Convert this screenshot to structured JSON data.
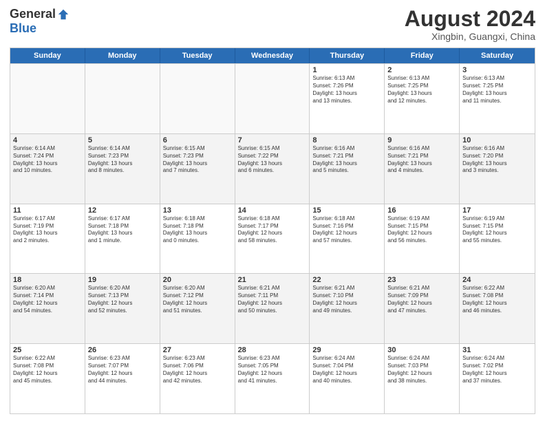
{
  "logo": {
    "general": "General",
    "blue": "Blue"
  },
  "title": "August 2024",
  "location": "Xingbin, Guangxi, China",
  "header_days": [
    "Sunday",
    "Monday",
    "Tuesday",
    "Wednesday",
    "Thursday",
    "Friday",
    "Saturday"
  ],
  "rows": [
    [
      {
        "num": "",
        "text": "",
        "empty": true
      },
      {
        "num": "",
        "text": "",
        "empty": true
      },
      {
        "num": "",
        "text": "",
        "empty": true
      },
      {
        "num": "",
        "text": "",
        "empty": true
      },
      {
        "num": "1",
        "text": "Sunrise: 6:13 AM\nSunset: 7:26 PM\nDaylight: 13 hours\nand 13 minutes.",
        "empty": false
      },
      {
        "num": "2",
        "text": "Sunrise: 6:13 AM\nSunset: 7:25 PM\nDaylight: 13 hours\nand 12 minutes.",
        "empty": false
      },
      {
        "num": "3",
        "text": "Sunrise: 6:13 AM\nSunset: 7:25 PM\nDaylight: 13 hours\nand 11 minutes.",
        "empty": false
      }
    ],
    [
      {
        "num": "4",
        "text": "Sunrise: 6:14 AM\nSunset: 7:24 PM\nDaylight: 13 hours\nand 10 minutes.",
        "empty": false
      },
      {
        "num": "5",
        "text": "Sunrise: 6:14 AM\nSunset: 7:23 PM\nDaylight: 13 hours\nand 8 minutes.",
        "empty": false
      },
      {
        "num": "6",
        "text": "Sunrise: 6:15 AM\nSunset: 7:23 PM\nDaylight: 13 hours\nand 7 minutes.",
        "empty": false
      },
      {
        "num": "7",
        "text": "Sunrise: 6:15 AM\nSunset: 7:22 PM\nDaylight: 13 hours\nand 6 minutes.",
        "empty": false
      },
      {
        "num": "8",
        "text": "Sunrise: 6:16 AM\nSunset: 7:21 PM\nDaylight: 13 hours\nand 5 minutes.",
        "empty": false
      },
      {
        "num": "9",
        "text": "Sunrise: 6:16 AM\nSunset: 7:21 PM\nDaylight: 13 hours\nand 4 minutes.",
        "empty": false
      },
      {
        "num": "10",
        "text": "Sunrise: 6:16 AM\nSunset: 7:20 PM\nDaylight: 13 hours\nand 3 minutes.",
        "empty": false
      }
    ],
    [
      {
        "num": "11",
        "text": "Sunrise: 6:17 AM\nSunset: 7:19 PM\nDaylight: 13 hours\nand 2 minutes.",
        "empty": false
      },
      {
        "num": "12",
        "text": "Sunrise: 6:17 AM\nSunset: 7:18 PM\nDaylight: 13 hours\nand 1 minute.",
        "empty": false
      },
      {
        "num": "13",
        "text": "Sunrise: 6:18 AM\nSunset: 7:18 PM\nDaylight: 13 hours\nand 0 minutes.",
        "empty": false
      },
      {
        "num": "14",
        "text": "Sunrise: 6:18 AM\nSunset: 7:17 PM\nDaylight: 12 hours\nand 58 minutes.",
        "empty": false
      },
      {
        "num": "15",
        "text": "Sunrise: 6:18 AM\nSunset: 7:16 PM\nDaylight: 12 hours\nand 57 minutes.",
        "empty": false
      },
      {
        "num": "16",
        "text": "Sunrise: 6:19 AM\nSunset: 7:15 PM\nDaylight: 12 hours\nand 56 minutes.",
        "empty": false
      },
      {
        "num": "17",
        "text": "Sunrise: 6:19 AM\nSunset: 7:15 PM\nDaylight: 12 hours\nand 55 minutes.",
        "empty": false
      }
    ],
    [
      {
        "num": "18",
        "text": "Sunrise: 6:20 AM\nSunset: 7:14 PM\nDaylight: 12 hours\nand 54 minutes.",
        "empty": false
      },
      {
        "num": "19",
        "text": "Sunrise: 6:20 AM\nSunset: 7:13 PM\nDaylight: 12 hours\nand 52 minutes.",
        "empty": false
      },
      {
        "num": "20",
        "text": "Sunrise: 6:20 AM\nSunset: 7:12 PM\nDaylight: 12 hours\nand 51 minutes.",
        "empty": false
      },
      {
        "num": "21",
        "text": "Sunrise: 6:21 AM\nSunset: 7:11 PM\nDaylight: 12 hours\nand 50 minutes.",
        "empty": false
      },
      {
        "num": "22",
        "text": "Sunrise: 6:21 AM\nSunset: 7:10 PM\nDaylight: 12 hours\nand 49 minutes.",
        "empty": false
      },
      {
        "num": "23",
        "text": "Sunrise: 6:21 AM\nSunset: 7:09 PM\nDaylight: 12 hours\nand 47 minutes.",
        "empty": false
      },
      {
        "num": "24",
        "text": "Sunrise: 6:22 AM\nSunset: 7:08 PM\nDaylight: 12 hours\nand 46 minutes.",
        "empty": false
      }
    ],
    [
      {
        "num": "25",
        "text": "Sunrise: 6:22 AM\nSunset: 7:08 PM\nDaylight: 12 hours\nand 45 minutes.",
        "empty": false
      },
      {
        "num": "26",
        "text": "Sunrise: 6:23 AM\nSunset: 7:07 PM\nDaylight: 12 hours\nand 44 minutes.",
        "empty": false
      },
      {
        "num": "27",
        "text": "Sunrise: 6:23 AM\nSunset: 7:06 PM\nDaylight: 12 hours\nand 42 minutes.",
        "empty": false
      },
      {
        "num": "28",
        "text": "Sunrise: 6:23 AM\nSunset: 7:05 PM\nDaylight: 12 hours\nand 41 minutes.",
        "empty": false
      },
      {
        "num": "29",
        "text": "Sunrise: 6:24 AM\nSunset: 7:04 PM\nDaylight: 12 hours\nand 40 minutes.",
        "empty": false
      },
      {
        "num": "30",
        "text": "Sunrise: 6:24 AM\nSunset: 7:03 PM\nDaylight: 12 hours\nand 38 minutes.",
        "empty": false
      },
      {
        "num": "31",
        "text": "Sunrise: 6:24 AM\nSunset: 7:02 PM\nDaylight: 12 hours\nand 37 minutes.",
        "empty": false
      }
    ]
  ]
}
